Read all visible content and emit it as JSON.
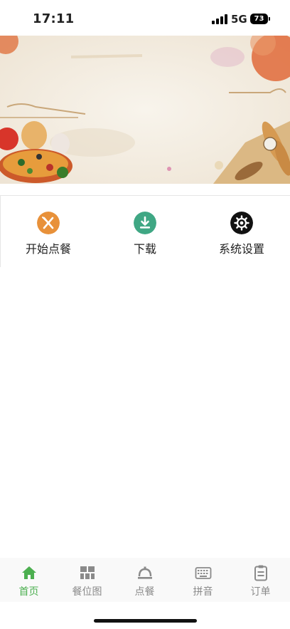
{
  "status_bar": {
    "time": "17:11",
    "network": "5G",
    "battery": "73"
  },
  "banner": {
    "image": "food-illustration-banner"
  },
  "menu": {
    "items": [
      {
        "label": "开始点餐",
        "icon": "fork-knife-icon",
        "color": "#e8913a"
      },
      {
        "label": "下载",
        "icon": "download-icon",
        "color": "#3fa784"
      },
      {
        "label": "系统设置",
        "icon": "gear-icon",
        "color": "#111111"
      }
    ]
  },
  "tabbar": {
    "active_color": "#4caf50",
    "inactive_color": "#8a8a8a",
    "tabs": [
      {
        "label": "首页",
        "icon": "home-icon",
        "active": true
      },
      {
        "label": "餐位图",
        "icon": "grid-icon",
        "active": false
      },
      {
        "label": "点餐",
        "icon": "service-bell-icon",
        "active": false
      },
      {
        "label": "拼音",
        "icon": "keyboard-icon",
        "active": false
      },
      {
        "label": "订单",
        "icon": "clipboard-icon",
        "active": false
      }
    ]
  }
}
